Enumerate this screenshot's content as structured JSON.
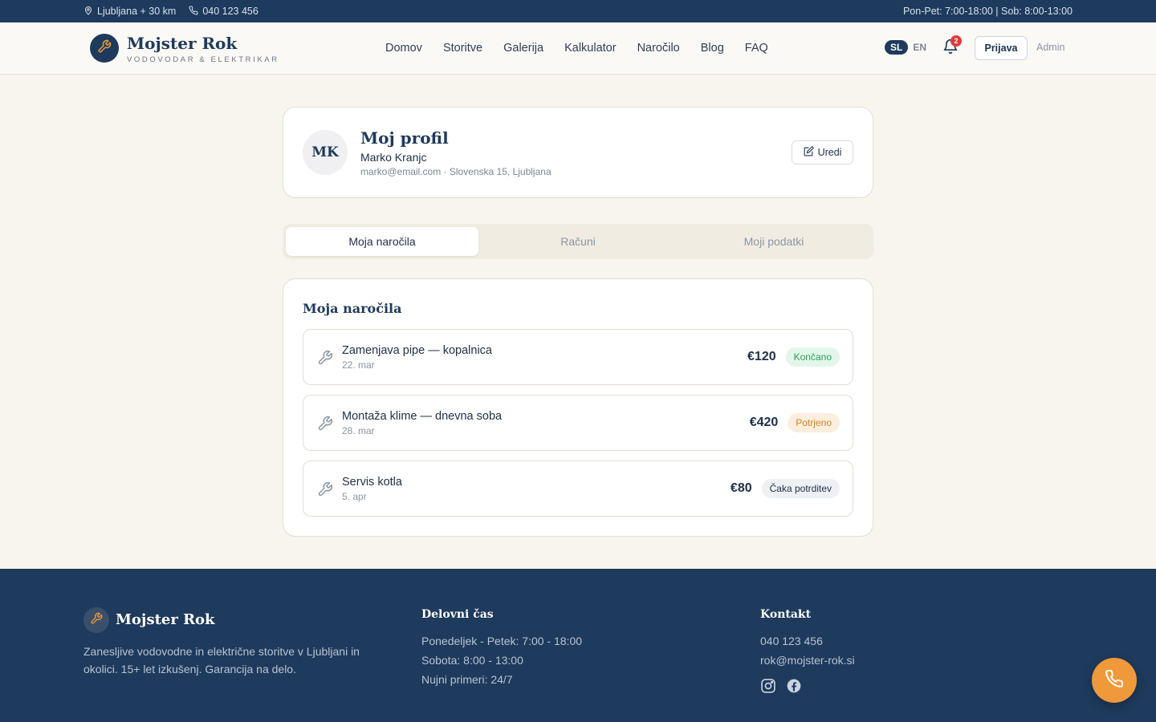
{
  "topbar": {
    "location": "Ljubljana + 30 km",
    "phone": "040 123 456",
    "hours": "Pon-Pet: 7:00-18:00 | Sob: 8:00-13:00"
  },
  "header": {
    "brand": "Mojster Rok",
    "tagline": "VODOVODAR & ELEKTRIKAR",
    "nav": [
      "Domov",
      "Storitve",
      "Galerija",
      "Kalkulator",
      "Naročilo",
      "Blog",
      "FAQ"
    ],
    "lang_active": "SL",
    "lang_other": "EN",
    "notification_count": "2",
    "login_label": "Prijava",
    "admin_label": "Admin"
  },
  "profile": {
    "initials": "MK",
    "title": "Moj profil",
    "name": "Marko Kranjc",
    "meta": "marko@email.com · Slovenska 15, Ljubljana",
    "edit_label": "Uredi"
  },
  "tabs": [
    "Moja naročila",
    "Računi",
    "Moji podatki"
  ],
  "orders": {
    "title": "Moja naročila",
    "items": [
      {
        "title": "Zamenjava pipe — kopalnica",
        "date": "22. mar",
        "price": "€120",
        "status": "Končano",
        "status_color": "#2e9e5b",
        "status_bg": "#e3f6ea"
      },
      {
        "title": "Montaža klime — dnevna soba",
        "date": "28. mar",
        "price": "€420",
        "status": "Potrjeno",
        "status_color": "#d9822b",
        "status_bg": "#fbeede"
      },
      {
        "title": "Servis kotla",
        "date": "5. apr",
        "price": "€80",
        "status": "Čaka potrditev",
        "status_color": "#1e2f4a",
        "status_bg": "#eef0f3"
      }
    ]
  },
  "footer": {
    "brand": "Mojster Rok",
    "description": "Zanesljive vodovodne in električne storitve v Ljubljani in okolici. 15+ let izkušenj. Garancija na delo.",
    "hours_title": "Delovni čas",
    "hours_lines": [
      "Ponedeljek - Petek: 7:00 - 18:00",
      "Sobota: 8:00 - 13:00",
      "Nujni primeri: 24/7"
    ],
    "contact_title": "Kontakt",
    "contact_phone": "040 123 456",
    "contact_email": "rok@mojster-rok.si"
  },
  "colors": {
    "navy": "#1e3a5c",
    "accent": "#f0993a",
    "background": "#f8f5ef"
  },
  "icons": [
    "map-pin-icon",
    "phone-icon",
    "wrench-icon",
    "bell-icon",
    "edit-icon",
    "instagram-icon",
    "facebook-icon"
  ]
}
